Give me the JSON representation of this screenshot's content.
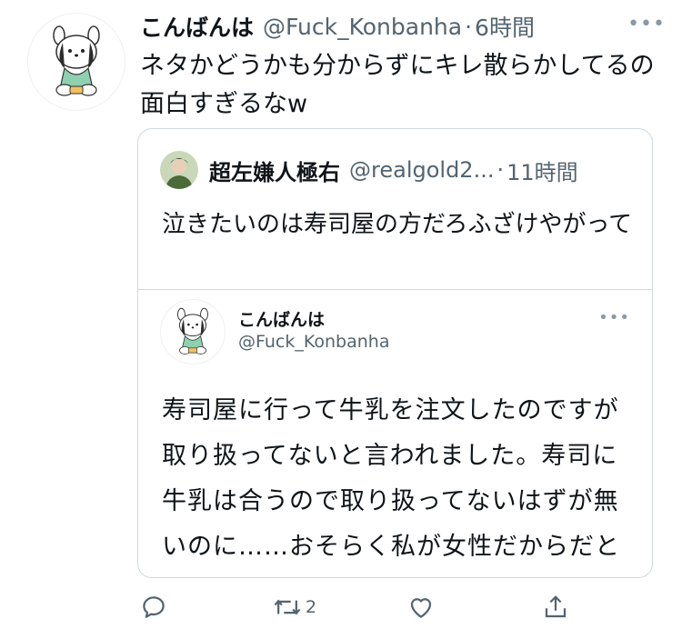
{
  "tweet": {
    "display_name": "こんばんは",
    "handle": "@Fuck_Konbanha",
    "separator": "·",
    "time": "6時間",
    "more_icon": "more-icon",
    "text": "ネタかどうかも分からずにキレ散らかしてるの面白すぎるなw"
  },
  "quote": {
    "display_name": "超左嫌人極右",
    "handle": "@realgold2...",
    "separator": "·",
    "time": "11時間",
    "text": "泣きたいのは寿司屋の方だろふざけやがって",
    "embedded": {
      "display_name": "こんばんは",
      "handle": "@Fuck_Konbanha",
      "text": "寿司屋に行って牛乳を注文したのですが取り扱ってないと言われました。寿司に牛乳は合うので取り扱ってないはずが無いのに……おそらく私が女性だからだと思いま"
    }
  },
  "actions": {
    "reply_icon": "reply-icon",
    "retweet_icon": "retweet-icon",
    "retweet_count": "2",
    "like_icon": "heart-icon",
    "share_icon": "share-icon"
  },
  "colors": {
    "text": "#0f1419",
    "secondary": "#536471",
    "border": "#cfd9de",
    "quote_avatar_green": "#4a6a3a"
  }
}
